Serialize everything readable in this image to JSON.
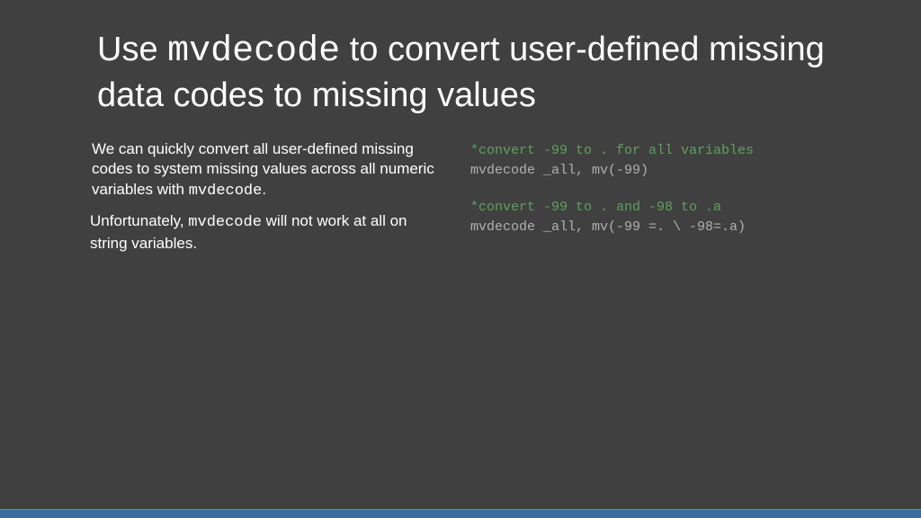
{
  "title": {
    "prefix": "Use ",
    "command": "mvdecode",
    "suffix": " to convert user-defined missing data codes to missing values"
  },
  "left": {
    "para1_prefix": "We can quickly convert all user-defined missing codes to system missing values across all numeric variables with ",
    "para1_cmd": "mvdecode",
    "para1_suffix": ".",
    "para2_prefix": "Unfortunately, ",
    "para2_cmd": "mvdecode",
    "para2_suffix": " will not work at all on string variables."
  },
  "right": {
    "block1_comment": "*convert -99 to . for all variables",
    "block1_code": "mvdecode _all, mv(-99)",
    "block2_comment": "*convert -99 to . and -98 to .a",
    "block2_code": "mvdecode _all, mv(-99 =. \\ -98=.a)"
  }
}
